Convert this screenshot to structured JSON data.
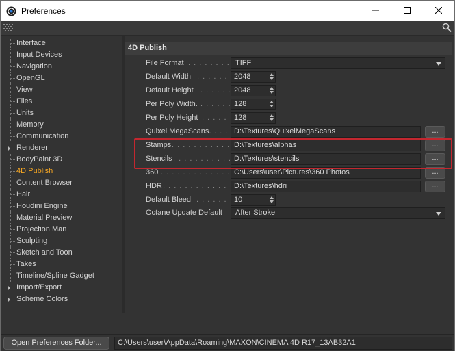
{
  "window": {
    "title": "Preferences",
    "controls": {
      "minimize": "—",
      "maximize": "☐",
      "close": "✕"
    }
  },
  "sidebar": {
    "active_color": "#f5a623",
    "items": [
      {
        "label": "Interface"
      },
      {
        "label": "Input Devices"
      },
      {
        "label": "Navigation"
      },
      {
        "label": "OpenGL"
      },
      {
        "label": "View"
      },
      {
        "label": "Files"
      },
      {
        "label": "Units"
      },
      {
        "label": "Memory"
      },
      {
        "label": "Communication"
      },
      {
        "label": "Renderer",
        "expandable": true
      },
      {
        "label": "BodyPaint 3D"
      },
      {
        "label": "4D Publish",
        "selected": true
      },
      {
        "label": "Content Browser"
      },
      {
        "label": "Hair"
      },
      {
        "label": "Houdini Engine"
      },
      {
        "label": "Material Preview"
      },
      {
        "label": "Projection Man"
      },
      {
        "label": "Sculpting"
      },
      {
        "label": "Sketch and Toon"
      },
      {
        "label": "Takes"
      },
      {
        "label": "Timeline/Spline Gadget"
      },
      {
        "label": "Import/Export",
        "expandable": true
      },
      {
        "label": "Scheme Colors",
        "expandable": true
      }
    ]
  },
  "panel": {
    "title": "4D Publish",
    "rows": [
      {
        "label": "File Format",
        "dots": ". . . . . . . . . .",
        "type": "dropdown",
        "value": "TIFF"
      },
      {
        "label": "Default Width",
        "dots": ". . . . . . .",
        "type": "number",
        "value": "2048"
      },
      {
        "label": "Default Height",
        "dots": ". . . . . . .",
        "type": "number",
        "value": "2048"
      },
      {
        "label": "Per Poly Width.",
        "dots": ". . . . . . .",
        "type": "number",
        "value": "128"
      },
      {
        "label": "Per Poly Height",
        "dots": ". . . . . . .",
        "type": "number",
        "value": "128"
      },
      {
        "label": "Quixel MegaScans.",
        "dots": ". . . .",
        "type": "path",
        "value": "D:\\Textures\\QuixelMegaScans",
        "button": "..."
      },
      {
        "label": "Stamps",
        "dots": ". . . . . . . . . . . . . . .",
        "type": "path",
        "value": "D:\\Textures\\alphas",
        "button": "..."
      },
      {
        "label": "Stencils",
        "dots": ". . . . . . . . . . . . . .",
        "type": "path",
        "value": "D:\\Textures\\stencils",
        "button": "..."
      },
      {
        "label": "360",
        "dots": ". . . . . . . . . . . . . . . . .",
        "type": "path",
        "value": "C:\\Users\\user\\Pictures\\360 Photos",
        "button": "..."
      },
      {
        "label": "HDR",
        "dots": ". . . . . . . . . . . . . . . . .",
        "type": "path",
        "value": "D:\\Textures\\hdri",
        "button": "..."
      },
      {
        "label": "Default Bleed",
        "dots": ". . . . . . . . .",
        "type": "number",
        "value": "10"
      },
      {
        "label": "Octane Update Default",
        "dots": "",
        "type": "dropdown",
        "value": "After Stroke"
      }
    ],
    "highlight_color": "#c3272f"
  },
  "statusbar": {
    "button_label": "Open Preferences Folder...",
    "path": "C:\\Users\\user\\AppData\\Roaming\\MAXON\\CINEMA 4D R17_13AB32A1"
  }
}
